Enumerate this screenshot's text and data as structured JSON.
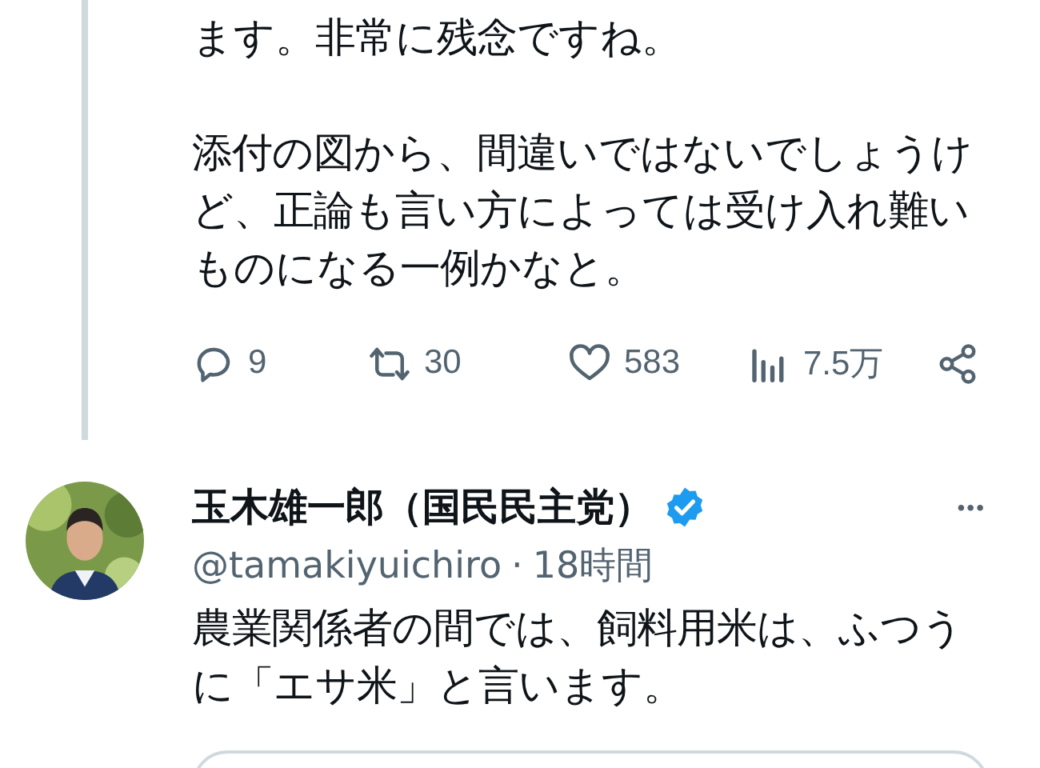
{
  "parent_tweet": {
    "paragraphs": [
      "ます。非常に残念ですね。",
      "添付の図から、間違いではないでしょうけど、正論も言い方によっては受け入れ難いものになる一例かなと。"
    ],
    "actions": [
      {
        "kind": "reply",
        "count": "9"
      },
      {
        "kind": "retweet",
        "count": "30"
      },
      {
        "kind": "like",
        "count": "583"
      },
      {
        "kind": "views",
        "count": "7.5万"
      },
      {
        "kind": "share"
      }
    ]
  },
  "tweet": {
    "name": "玉木雄一郎（国民民主党）",
    "verified": true,
    "handle": "@tamakiyuichiro",
    "separator": "·",
    "time": "18時間",
    "more": "•••",
    "text": "農業関係者の間では、飼料用米は、ふつうに「エサ米」と言います。"
  }
}
